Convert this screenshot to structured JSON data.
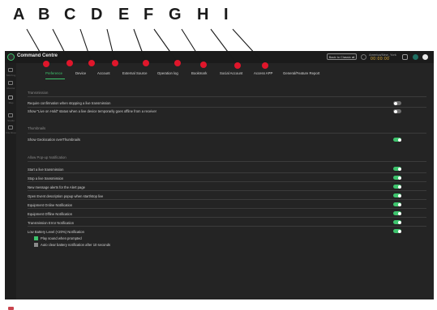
{
  "callouts": [
    "A",
    "B",
    "C",
    "D",
    "E",
    "F",
    "G",
    "H",
    "I"
  ],
  "app": {
    "title": "Command Centre",
    "back_label": "Back to Classic ⇄",
    "timezone": "America/New_York",
    "clock": "00:00:00"
  },
  "sidebar": {
    "items": [
      {
        "label": "Stitching",
        "icon": "broadcast-icon"
      },
      {
        "label": "Monitor",
        "icon": "monitor-icon"
      },
      {
        "label": "Map",
        "icon": "map-icon"
      },
      {
        "label": "Studio",
        "icon": "studio-icon"
      },
      {
        "label": "File Drop",
        "icon": "file-icon"
      }
    ]
  },
  "tabs": [
    {
      "label": "Preference",
      "active": true
    },
    {
      "label": "Device",
      "active": false
    },
    {
      "label": "Account",
      "active": false
    },
    {
      "label": "External Source",
      "active": false
    },
    {
      "label": "Operation log",
      "active": false
    },
    {
      "label": "Bookmark",
      "active": false
    },
    {
      "label": "Social Account",
      "active": false
    },
    {
      "label": "Access APP",
      "active": false
    },
    {
      "label": "General/Feature Report",
      "active": false
    }
  ],
  "sections": {
    "transmission": {
      "heading": "Transmission",
      "rows": [
        {
          "label": "Require confirmation when stopping a live transmission",
          "on": false
        },
        {
          "label": "Show \"Live on Hold\" status when a live device temporarily goes offline from a receiver",
          "on": false
        }
      ]
    },
    "thumbnails": {
      "heading": "Thumbnails",
      "rows": [
        {
          "label": "Show Geolocation overThumbnails",
          "on": true
        }
      ]
    },
    "popup": {
      "heading": "Allow Pop-up Notification",
      "rows": [
        {
          "label": "Start a live transmission",
          "on": true
        },
        {
          "label": "Stop a live transmission",
          "on": true
        },
        {
          "label": "New message alerts for the Alert page",
          "on": true
        },
        {
          "label": "Open Event description popup when start/stop live",
          "on": true
        },
        {
          "label": "Equipment Online Notification",
          "on": true
        },
        {
          "label": "Equipment Offline Notification",
          "on": true
        },
        {
          "label": "Transmission Error Notification",
          "on": true
        },
        {
          "label": "Low Battery Level (<20%) Notification",
          "on": true
        }
      ],
      "suboptions": [
        {
          "label": "Play sound when prompted",
          "checked": true
        },
        {
          "label": "Auto clear battery notification after 10 seconds",
          "checked": false
        }
      ]
    }
  }
}
